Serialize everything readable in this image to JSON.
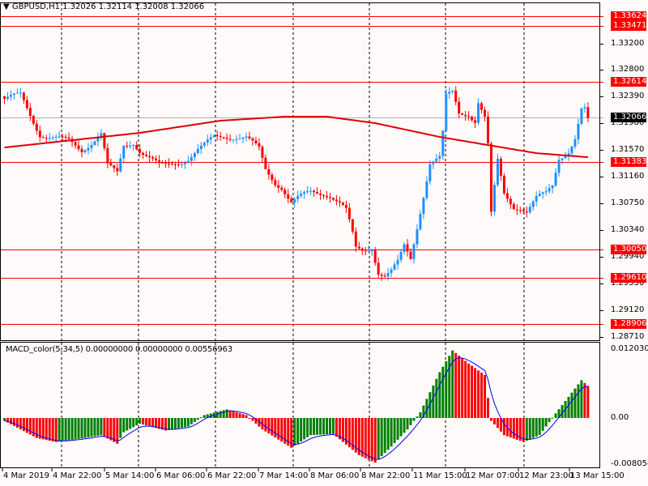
{
  "header": {
    "symbol": "GBPUSD,H1",
    "ohlc": "1.32026 1.32114 1.32008 1.32066"
  },
  "colors": {
    "bull": "#1e90ff",
    "bear": "#ff0000",
    "level": "#ff0000",
    "ma": "#e00000",
    "hist_up": "#008000",
    "hist_down": "#ff0000",
    "signal": "#0000ff",
    "current": "#000000"
  },
  "chart_data": [
    {
      "type": "candlestick",
      "title": "GBPUSD,H1",
      "ylim": [
        1.2862,
        1.3402
      ],
      "price_ticks": [
        "1.33200",
        "1.32800",
        "1.32390",
        "1.31980",
        "1.31570",
        "1.31160",
        "1.30750",
        "1.30340",
        "1.29940",
        "1.29530",
        "1.29120",
        "1.28710"
      ],
      "levels": [
        "1.33624",
        "1.33471",
        "1.32614",
        "1.31383",
        "1.30050",
        "1.29610",
        "1.28906"
      ],
      "current_price": "1.32066",
      "bar_count": 182,
      "close_anchors": [
        [
          0,
          1.32357
        ],
        [
          5,
          1.32406
        ],
        [
          9,
          1.32009
        ],
        [
          11,
          1.31823
        ],
        [
          15,
          1.31761
        ],
        [
          20,
          1.31699
        ],
        [
          24,
          1.31574
        ],
        [
          30,
          1.31823
        ],
        [
          32,
          1.31326
        ],
        [
          35,
          1.31202
        ],
        [
          37,
          1.31636
        ],
        [
          40,
          1.31699
        ],
        [
          42,
          1.31574
        ],
        [
          45,
          1.3145
        ],
        [
          48,
          1.31326
        ],
        [
          50,
          1.31326
        ],
        [
          54,
          1.31388
        ],
        [
          57,
          1.3145
        ],
        [
          60,
          1.31574
        ],
        [
          62,
          1.31636
        ],
        [
          65,
          1.31761
        ],
        [
          68,
          1.31785
        ],
        [
          71,
          1.31785
        ],
        [
          75,
          1.31761
        ],
        [
          79,
          1.31574
        ],
        [
          81,
          1.31264
        ],
        [
          84,
          1.31078
        ],
        [
          86,
          1.31015
        ],
        [
          89,
          1.30767
        ],
        [
          91,
          1.30829
        ],
        [
          95,
          1.30916
        ],
        [
          99,
          1.30916
        ],
        [
          101,
          1.30891
        ],
        [
          104,
          1.30767
        ],
        [
          106,
          1.30643
        ],
        [
          108,
          1.3027
        ],
        [
          109,
          1.30046
        ],
        [
          111,
          1.30021
        ],
        [
          114,
          1.30084
        ],
        [
          116,
          1.29711
        ],
        [
          118,
          1.29649
        ],
        [
          120,
          1.29711
        ],
        [
          122,
          1.29835
        ],
        [
          124,
          1.30084
        ],
        [
          126,
          1.29898
        ],
        [
          128,
          1.30394
        ],
        [
          130,
          1.30891
        ],
        [
          132,
          1.31388
        ],
        [
          135,
          1.3145
        ],
        [
          136,
          1.31823
        ],
        [
          137,
          1.32382
        ],
        [
          139,
          1.32444
        ],
        [
          141,
          1.32134
        ],
        [
          144,
          1.32134
        ],
        [
          146,
          1.32034
        ],
        [
          147,
          1.3232
        ],
        [
          149,
          1.32071
        ],
        [
          150,
          1.31636
        ],
        [
          151,
          1.30579
        ],
        [
          153,
          1.31388
        ],
        [
          155,
          1.30891
        ],
        [
          158,
          1.30705
        ],
        [
          160,
          1.30705
        ],
        [
          162,
          1.30643
        ],
        [
          165,
          1.30829
        ],
        [
          168,
          1.30891
        ],
        [
          170,
          1.31015
        ],
        [
          172,
          1.3145
        ],
        [
          175,
          1.31574
        ],
        [
          177,
          1.31761
        ],
        [
          179,
          1.32189
        ],
        [
          180,
          1.32189
        ],
        [
          181,
          1.32066
        ]
      ],
      "ma_anchors": [
        [
          0,
          1.31611
        ],
        [
          42,
          1.31835
        ],
        [
          67,
          1.32022
        ],
        [
          87,
          1.32084
        ],
        [
          100,
          1.32084
        ],
        [
          115,
          1.31984
        ],
        [
          135,
          1.31773
        ],
        [
          150,
          1.31648
        ],
        [
          165,
          1.31524
        ],
        [
          181,
          1.31462
        ]
      ]
    },
    {
      "type": "bar",
      "title": "MACD_color(5,34,5) 0.00000000 0.00000000 0.00556963",
      "ticks": [
        "0.0120303",
        "0.00",
        "-0.008054"
      ],
      "ylim": [
        -0.008054,
        0.0120303
      ],
      "hist_anchors": [
        [
          0,
          -0.0005
        ],
        [
          10,
          -0.0035
        ],
        [
          16,
          -0.0042
        ],
        [
          25,
          -0.0035
        ],
        [
          30,
          -0.003
        ],
        [
          35,
          -0.0045
        ],
        [
          37,
          -0.0025
        ],
        [
          42,
          -0.001
        ],
        [
          50,
          -0.0022
        ],
        [
          57,
          -0.0015
        ],
        [
          62,
          0.0005
        ],
        [
          69,
          0.0015
        ],
        [
          75,
          0.0005
        ],
        [
          80,
          -0.002
        ],
        [
          89,
          -0.0052
        ],
        [
          95,
          -0.003
        ],
        [
          102,
          -0.0028
        ],
        [
          110,
          -0.0065
        ],
        [
          115,
          -0.0078
        ],
        [
          120,
          -0.005
        ],
        [
          125,
          -0.002
        ],
        [
          129,
          0.001
        ],
        [
          135,
          0.008
        ],
        [
          139,
          0.0118
        ],
        [
          144,
          0.0095
        ],
        [
          149,
          0.0075
        ],
        [
          151,
          -0.0005
        ],
        [
          155,
          -0.003
        ],
        [
          161,
          -0.0042
        ],
        [
          166,
          -0.003
        ],
        [
          171,
          0.0008
        ],
        [
          179,
          0.0066
        ],
        [
          181,
          0.0056
        ]
      ]
    }
  ],
  "time_labels": [
    "4 Mar 2019",
    "4 Mar 22:00",
    "5 Mar 14:00",
    "6 Mar 06:00",
    "6 Mar 22:00",
    "7 Mar 14:00",
    "8 Mar 06:00",
    "8 Mar 22:00",
    "11 Mar 15:00",
    "12 Mar 07:00",
    "12 Mar 23:00",
    "13 Mar 15:00"
  ]
}
